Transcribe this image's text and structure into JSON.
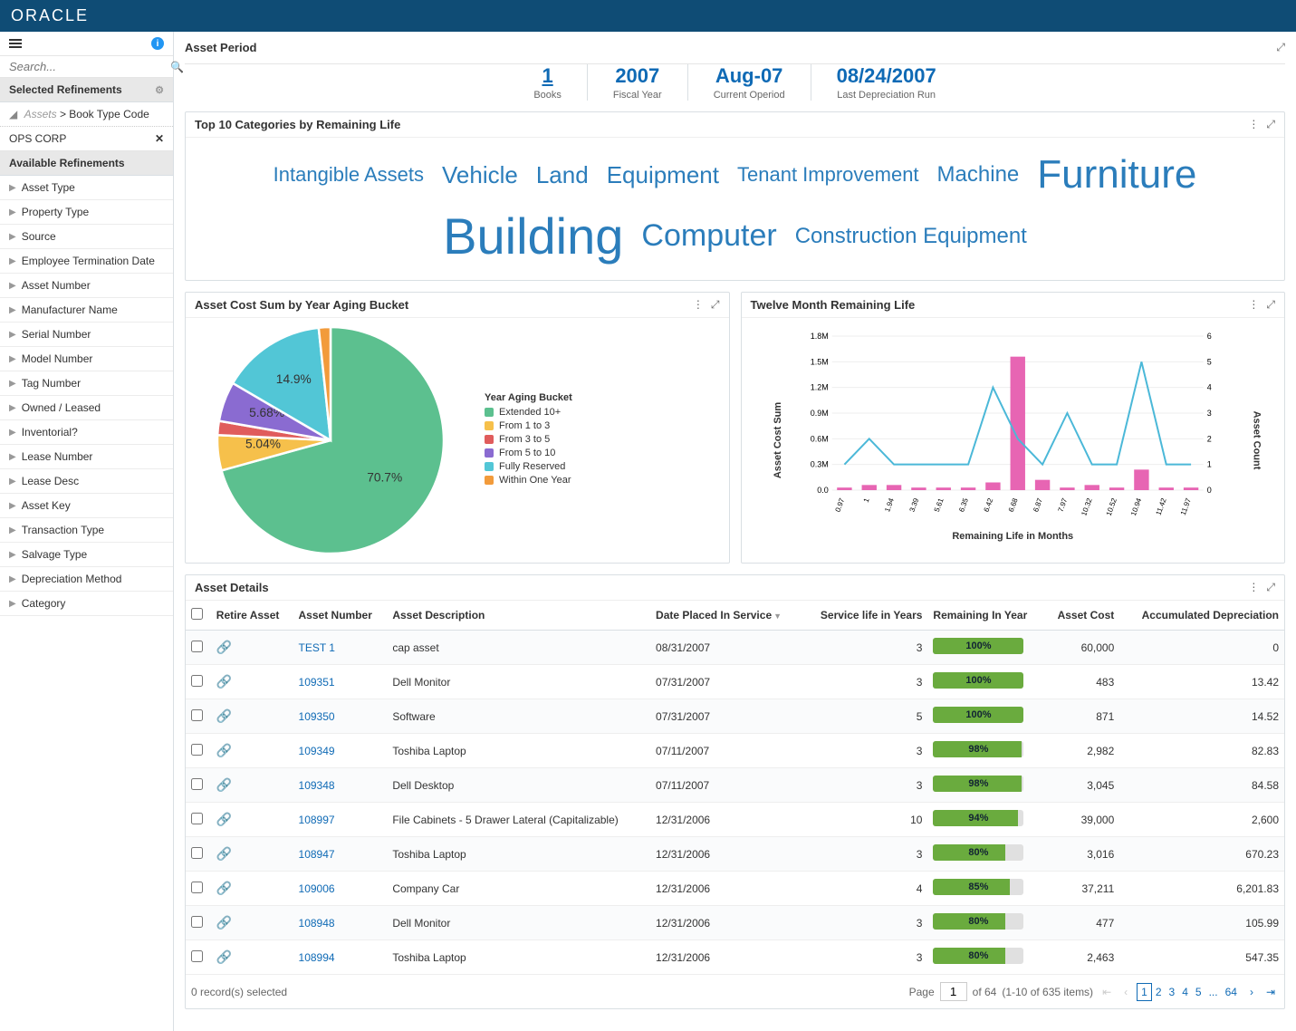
{
  "brand": "ORACLE",
  "sidebar": {
    "search_placeholder": "Search...",
    "selected_refinements_label": "Selected Refinements",
    "breadcrumb_dim": "Assets",
    "breadcrumb_sep": ">",
    "breadcrumb_leaf": "Book Type Code",
    "chip": "OPS CORP",
    "available_refinements_label": "Available Refinements",
    "items": [
      "Asset Type",
      "Property Type",
      "Source",
      "Employee Termination Date",
      "Asset Number",
      "Manufacturer Name",
      "Serial Number",
      "Model Number",
      "Tag Number",
      "Owned / Leased",
      "Inventorial?",
      "Lease Number",
      "Lease Desc",
      "Asset Key",
      "Transaction Type",
      "Salvage Type",
      "Depreciation Method",
      "Category"
    ]
  },
  "asset_period": {
    "title": "Asset Period",
    "kpis": [
      {
        "value": "1",
        "label": "Books",
        "link": true
      },
      {
        "value": "2007",
        "label": "Fiscal Year"
      },
      {
        "value": "Aug-07",
        "label": "Current Operiod"
      },
      {
        "value": "08/24/2007",
        "label": "Last Depreciation Run"
      }
    ]
  },
  "top_categories": {
    "title": "Top 10 Categories by Remaining Life",
    "words": [
      {
        "text": "Intangible Assets",
        "size": 22
      },
      {
        "text": "Vehicle",
        "size": 26
      },
      {
        "text": "Land",
        "size": 26
      },
      {
        "text": "Equipment",
        "size": 26
      },
      {
        "text": "Tenant Improvement",
        "size": 22
      },
      {
        "text": "Machine",
        "size": 24
      },
      {
        "text": "Furniture",
        "size": 44
      },
      {
        "text": "Building",
        "size": 56
      },
      {
        "text": "Computer",
        "size": 34
      },
      {
        "text": "Construction Equipment",
        "size": 24
      }
    ]
  },
  "chart_data": [
    {
      "type": "pie",
      "title": "Asset Cost Sum by Year Aging Bucket",
      "legend_title": "Year Aging Bucket",
      "slices": [
        {
          "label": "Extended 10+",
          "pct": 70.7,
          "color": "#5cc08f"
        },
        {
          "label": "From 1 to 3",
          "pct": 5.04,
          "color": "#f6c04b"
        },
        {
          "label": "From 3 to 5",
          "pct": 2.0,
          "color": "#e05c5c"
        },
        {
          "label": "From 5 to 10",
          "pct": 5.68,
          "color": "#8a6bd1"
        },
        {
          "label": "Fully Reserved",
          "pct": 14.9,
          "color": "#52c6d6"
        },
        {
          "label": "Within One Year",
          "pct": 1.68,
          "color": "#f29b3b"
        }
      ],
      "visible_labels": [
        "70.7%",
        "5.04%",
        "5.68%",
        "14.9%"
      ]
    },
    {
      "type": "combo",
      "title": "Twelve Month Remaining Life",
      "xlabel": "Remaining Life in Months",
      "ylabel_left": "Asset Cost Sum",
      "ylabel_right": "Asset Count",
      "y_left_ticks": [
        "0.0",
        "0.3M",
        "0.6M",
        "0.9M",
        "1.2M",
        "1.5M",
        "1.8M"
      ],
      "y_left_range": [
        0,
        1800000
      ],
      "y_right_ticks": [
        "0",
        "1",
        "2",
        "3",
        "4",
        "5",
        "6"
      ],
      "y_right_range": [
        0,
        6
      ],
      "categories": [
        "0.97",
        "1",
        "1.94",
        "3.39",
        "5.61",
        "6.35",
        "6.42",
        "6.68",
        "6.87",
        "7.97",
        "10.32",
        "10.52",
        "10.94",
        "11.42",
        "11.97"
      ],
      "series": [
        {
          "name": "Asset Cost Sum",
          "chart": "bar",
          "color": "#e765b3",
          "values": [
            30000,
            60000,
            60000,
            30000,
            30000,
            30000,
            90000,
            1560000,
            120000,
            30000,
            60000,
            30000,
            240000,
            30000,
            30000
          ]
        },
        {
          "name": "Asset Count",
          "chart": "line",
          "color": "#4bb8d8",
          "values": [
            1,
            2,
            1,
            1,
            1,
            1,
            4,
            2,
            1,
            3,
            1,
            1,
            5,
            1,
            1
          ]
        }
      ]
    }
  ],
  "details": {
    "title": "Asset Details",
    "columns": [
      "",
      "Retire Asset",
      "Asset Number",
      "Asset Description",
      "Date Placed In Service",
      "Service life in Years",
      "Remaining In Year",
      "Asset Cost",
      "Accumulated Depreciation"
    ],
    "rows": [
      {
        "num": "TEST 1",
        "desc": "cap asset",
        "date": "08/31/2007",
        "life": "3",
        "remain": 100,
        "cost": "60,000",
        "dep": "0"
      },
      {
        "num": "109351",
        "desc": "Dell Monitor",
        "date": "07/31/2007",
        "life": "3",
        "remain": 100,
        "cost": "483",
        "dep": "13.42"
      },
      {
        "num": "109350",
        "desc": "Software",
        "date": "07/31/2007",
        "life": "5",
        "remain": 100,
        "cost": "871",
        "dep": "14.52"
      },
      {
        "num": "109349",
        "desc": "Toshiba Laptop",
        "date": "07/11/2007",
        "life": "3",
        "remain": 98,
        "cost": "2,982",
        "dep": "82.83"
      },
      {
        "num": "109348",
        "desc": "Dell Desktop",
        "date": "07/11/2007",
        "life": "3",
        "remain": 98,
        "cost": "3,045",
        "dep": "84.58"
      },
      {
        "num": "108997",
        "desc": "File Cabinets - 5 Drawer Lateral (Capitalizable)",
        "date": "12/31/2006",
        "life": "10",
        "remain": 94,
        "cost": "39,000",
        "dep": "2,600"
      },
      {
        "num": "108947",
        "desc": "Toshiba Laptop",
        "date": "12/31/2006",
        "life": "3",
        "remain": 80,
        "cost": "3,016",
        "dep": "670.23"
      },
      {
        "num": "109006",
        "desc": "Company Car",
        "date": "12/31/2006",
        "life": "4",
        "remain": 85,
        "cost": "37,211",
        "dep": "6,201.83"
      },
      {
        "num": "108948",
        "desc": "Dell Monitor",
        "date": "12/31/2006",
        "life": "3",
        "remain": 80,
        "cost": "477",
        "dep": "105.99"
      },
      {
        "num": "108994",
        "desc": "Toshiba Laptop",
        "date": "12/31/2006",
        "life": "3",
        "remain": 80,
        "cost": "2,463",
        "dep": "547.35"
      }
    ],
    "selected_text": "0 record(s) selected",
    "pager": {
      "page_label": "Page",
      "current": "1",
      "of_label": "of 64",
      "range": "(1-10 of 635 items)",
      "links": [
        "1",
        "2",
        "3",
        "4",
        "5",
        "...",
        "64"
      ]
    }
  }
}
